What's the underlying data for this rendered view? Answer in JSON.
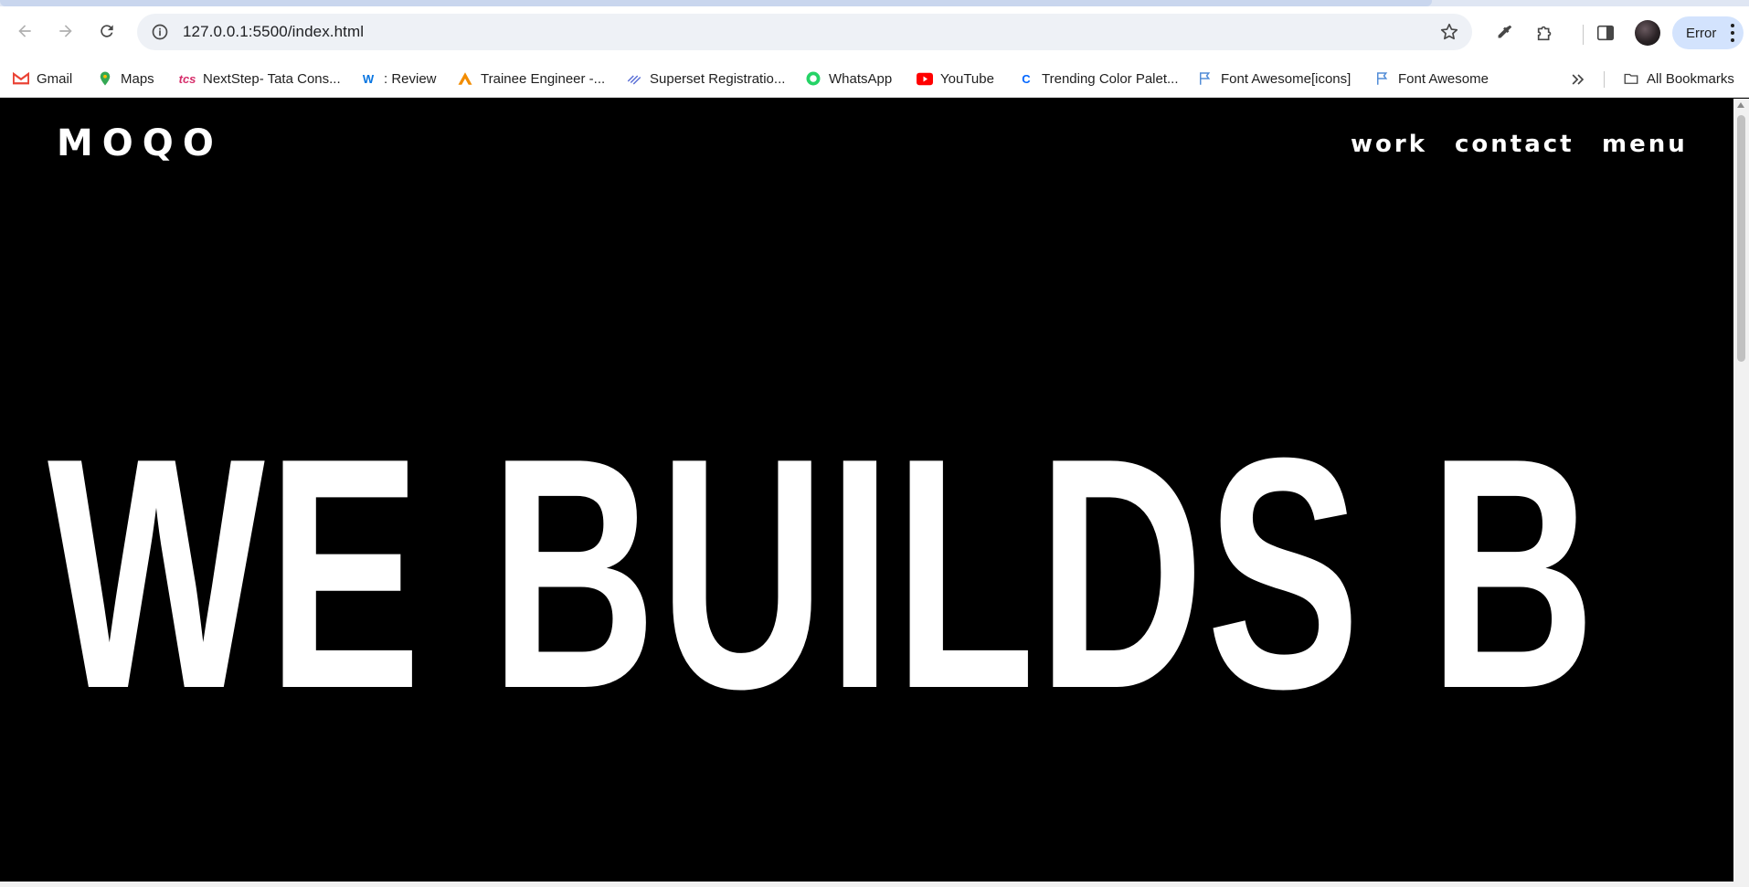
{
  "browser": {
    "url": "127.0.0.1:5500/index.html",
    "profile_status": "Error",
    "bookmarks": [
      {
        "label": "Gmail",
        "icon": "gmail-icon",
        "color": "#ea4335"
      },
      {
        "label": "Maps",
        "icon": "maps-icon",
        "color": "#34a853"
      },
      {
        "label": "NextStep- Tata Cons...",
        "icon": "tcs-icon",
        "color": "#d62d6a"
      },
      {
        "label": ": Review",
        "icon": "workday-icon",
        "color": "#0875e1"
      },
      {
        "label": "Trainee Engineer -...",
        "icon": "trainee-icon",
        "color": "#f28c00"
      },
      {
        "label": "Superset Registratio...",
        "icon": "superset-icon",
        "color": "#5a6fd6"
      },
      {
        "label": "WhatsApp",
        "icon": "whatsapp-icon",
        "color": "#25d366"
      },
      {
        "label": "YouTube",
        "icon": "youtube-icon",
        "color": "#ff0000"
      },
      {
        "label": "Trending Color Palet...",
        "icon": "coolors-icon",
        "color": "#0066ff"
      },
      {
        "label": "Font Awesome[icons]",
        "icon": "flag-icon",
        "color": "#538dd7"
      },
      {
        "label": "Font Awesome",
        "icon": "flag-icon",
        "color": "#538dd7"
      }
    ],
    "all_bookmarks_label": "All Bookmarks"
  },
  "site": {
    "logo": "MOQO",
    "nav": {
      "work": "work",
      "contact": "contact",
      "menu": "menu"
    },
    "hero": "WE BUILDS B"
  },
  "colors": {
    "page_background": "#000000",
    "text": "#ffffff",
    "error_chip": "#d3e3fd"
  }
}
